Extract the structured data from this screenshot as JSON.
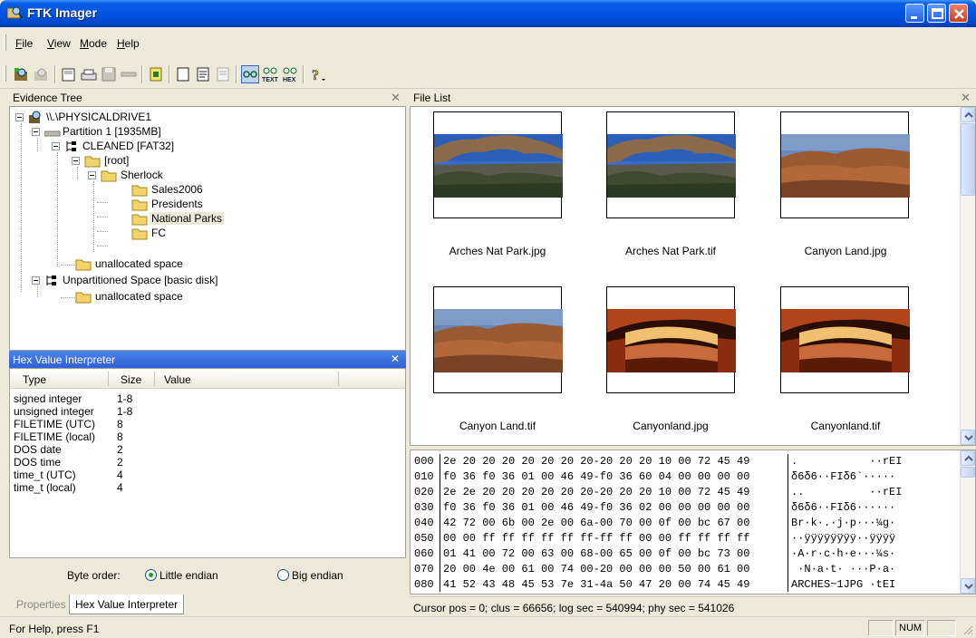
{
  "window": {
    "title": "FTK Imager"
  },
  "menu": {
    "items": [
      {
        "ul": "F",
        "rest": "ile"
      },
      {
        "ul": "V",
        "rest": "iew"
      },
      {
        "ul": "M",
        "rest": "ode"
      },
      {
        "ul": "H",
        "rest": "elp"
      }
    ]
  },
  "toolbar": {
    "icons": [
      "add-evidence-icon",
      "remove-evidence-icon",
      "create-image-icon",
      "export-disk-image-icon",
      "export-files-icon",
      "image-mounting-icon",
      "verify-drive-icon",
      "view-files-icon",
      "auto-view-icon",
      "text-view-icon",
      "hex-view-icon",
      "help-icon"
    ]
  },
  "evidence_tree": {
    "title": "Evidence Tree",
    "nodes": [
      {
        "label": "\\\\.\\PHYSICALDRIVE1",
        "icon": "drive-icon"
      },
      {
        "label": "Partition 1 [1935MB]",
        "icon": "partition-icon"
      },
      {
        "label": "CLEANED [FAT32]",
        "icon": "filesystem-icon"
      },
      {
        "label": "[root]",
        "icon": "folder-icon"
      },
      {
        "label": "Sherlock",
        "icon": "folder-icon"
      },
      {
        "label": "Sales2006",
        "icon": "folder-icon"
      },
      {
        "label": "Presidents",
        "icon": "folder-icon"
      },
      {
        "label": "National Parks",
        "icon": "folder-icon",
        "selected": true
      },
      {
        "label": "FC",
        "icon": "folder-icon"
      },
      {
        "label": "unallocated space",
        "icon": "folder-icon"
      },
      {
        "label": "Unpartitioned Space [basic disk]",
        "icon": "filesystem-icon"
      },
      {
        "label": "unallocated space",
        "icon": "folder-icon"
      }
    ]
  },
  "hex_interpreter": {
    "title": "Hex Value Interpreter",
    "columns": [
      "Type",
      "Size",
      "Value"
    ],
    "rows": [
      {
        "type": "signed integer",
        "size": "1-8",
        "value": ""
      },
      {
        "type": "unsigned integer",
        "size": "1-8",
        "value": ""
      },
      {
        "type": "FILETIME (UTC)",
        "size": "8",
        "value": ""
      },
      {
        "type": "FILETIME (local)",
        "size": "8",
        "value": ""
      },
      {
        "type": "DOS date",
        "size": "2",
        "value": ""
      },
      {
        "type": "DOS time",
        "size": "2",
        "value": ""
      },
      {
        "type": "time_t (UTC)",
        "size": "4",
        "value": ""
      },
      {
        "type": "time_t (local)",
        "size": "4",
        "value": ""
      }
    ],
    "byte_order_label": "Byte order:",
    "little_endian": "Little endian",
    "big_endian": "Big endian",
    "selected_order": "little"
  },
  "tabs": {
    "properties": "Properties",
    "hex_interpreter": "Hex Value Interpreter"
  },
  "file_list": {
    "title": "File List",
    "files": [
      {
        "name": "Arches Nat Park.jpg",
        "thumb": "arch"
      },
      {
        "name": "Arches Nat Park.tif",
        "thumb": "arch"
      },
      {
        "name": "Canyon Land.jpg",
        "thumb": "canyon"
      },
      {
        "name": "Canyon Land.tif",
        "thumb": "canyon"
      },
      {
        "name": "Canyonland.jpg",
        "thumb": "mesa"
      },
      {
        "name": "Canyonland.tif",
        "thumb": "mesa"
      }
    ]
  },
  "hex_view": {
    "rows": [
      {
        "offset": "000",
        "bytes": "2e 20 20 20 20 20 20 20-20 20 20 10 00 72 45 49",
        "ascii": ".           ··rEI"
      },
      {
        "offset": "010",
        "bytes": "f0 36 f0 36 01 00 46 49-f0 36 60 04 00 00 00 00",
        "ascii": "δ6δ6··FIδ6`·····"
      },
      {
        "offset": "020",
        "bytes": "2e 2e 20 20 20 20 20 20-20 20 20 10 00 72 45 49",
        "ascii": "..          ··rEI"
      },
      {
        "offset": "030",
        "bytes": "f0 36 f0 36 01 00 46 49-f0 36 02 00 00 00 00 00",
        "ascii": "δ6δ6··FIδ6······"
      },
      {
        "offset": "040",
        "bytes": "42 72 00 6b 00 2e 00 6a-00 70 00 0f 00 bc 67 00",
        "ascii": "Br·k·.·j·p···¼g·"
      },
      {
        "offset": "050",
        "bytes": "00 00 ff ff ff ff ff ff-ff ff 00 00 ff ff ff ff",
        "ascii": "··ÿÿÿÿÿÿÿÿ··ÿÿÿÿ"
      },
      {
        "offset": "060",
        "bytes": "01 41 00 72 00 63 00 68-00 65 00 0f 00 bc 73 00",
        "ascii": "·A·r·c·h·e···¼s·"
      },
      {
        "offset": "070",
        "bytes": "20 00 4e 00 61 00 74 00-20 00 00 00 50 00 61 00",
        "ascii": " ·N·a·t· ···P·a·"
      },
      {
        "offset": "080",
        "bytes": "41 52 43 48 45 53 7e 31-4a 50 47 20 00 74 45 49",
        "ascii": "ARCHES~1JPG ·tEI"
      }
    ]
  },
  "cursor_info": "Cursor pos = 0; clus = 66656; log sec = 540994; phy sec = 541026",
  "status": {
    "help": "For Help, press F1",
    "num": "NUM"
  },
  "colors": {
    "titlebar": "#0054e3",
    "face": "#ece9d8",
    "selection": "#316ac5"
  }
}
